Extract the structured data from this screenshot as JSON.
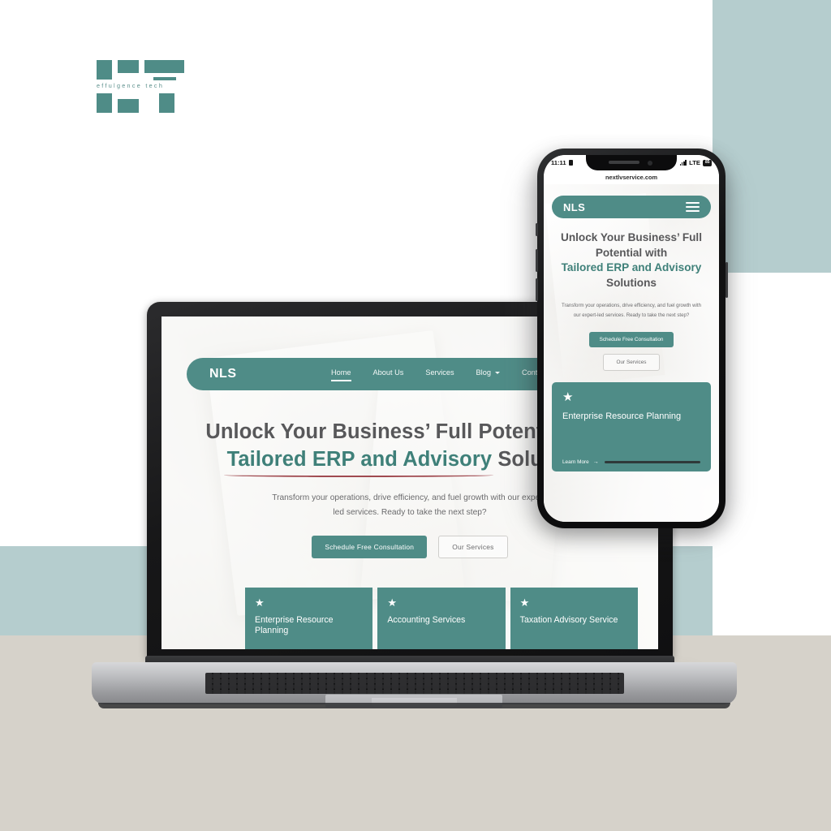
{
  "brand": {
    "logo_word": "effulgence tech",
    "accent_teal": "#4f8c87",
    "accent_dark_teal": "#3f8079",
    "underline_red": "#a04a50",
    "panel_blue": "#b5cdce",
    "panel_beige": "#d6d2ca"
  },
  "site": {
    "logo": "NLS",
    "nav": [
      {
        "label": "Home",
        "active": true,
        "caret": false
      },
      {
        "label": "About Us",
        "active": false,
        "caret": false
      },
      {
        "label": "Services",
        "active": false,
        "caret": false
      },
      {
        "label": "Blog",
        "active": false,
        "caret": true
      },
      {
        "label": "Contact Us",
        "active": false,
        "caret": false
      }
    ],
    "hero": {
      "line1": "Unlock Your Business’ Full Potential with",
      "accent": "Tailored ERP and Advisory",
      "line_tail": "Solutions",
      "paragraph": "Transform your operations, drive efficiency, and fuel growth with our expert-led services. Ready to take the next step?",
      "primary_button": "Schedule Free Consultation",
      "secondary_button": "Our Services"
    },
    "cards": [
      {
        "icon": "star-icon",
        "title": "Enterprise Resource Planning"
      },
      {
        "icon": "star-icon",
        "title": "Accounting Services"
      },
      {
        "icon": "star-icon",
        "title": "Taxation Advisory Service"
      }
    ]
  },
  "phone": {
    "status": {
      "time": "11:11",
      "sim_icon": "sim-card-icon",
      "signal_icon": "signal-bars-icon",
      "network": "LTE",
      "battery": "85"
    },
    "url": "nextlvservice.com",
    "logo": "NLS",
    "menu_icon": "hamburger-menu-icon",
    "hero": {
      "line1": "Unlock Your Business’ Full",
      "line2": "Potential with",
      "accent": "Tailored ERP and Advisory",
      "line_tail": "Solutions",
      "paragraph": "Transform your operations, drive efficiency, and fuel growth with our expert-led services. Ready to take the next step?",
      "primary_button": "Schedule Free Consultation",
      "secondary_button": "Our Services"
    },
    "card": {
      "icon": "star-icon",
      "title": "Enterprise Resource Planning",
      "learn_more": "Learn More",
      "arrow": "→"
    }
  }
}
